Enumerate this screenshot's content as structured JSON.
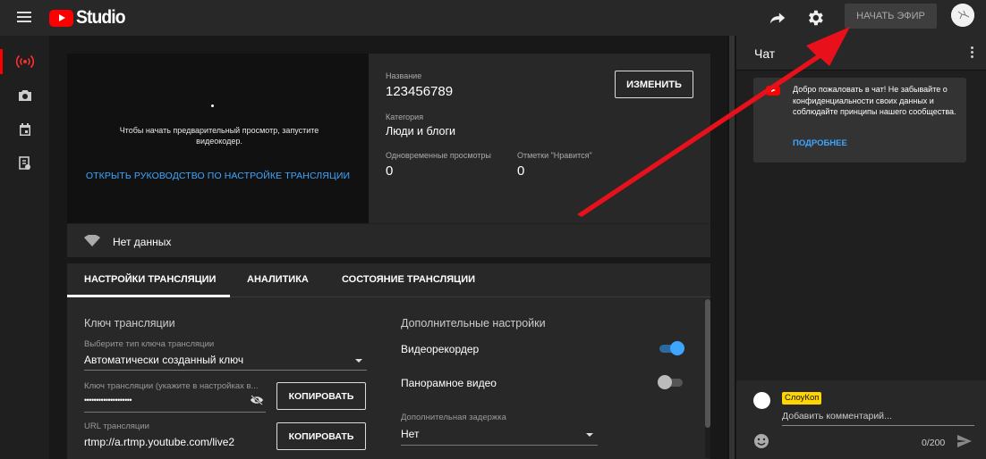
{
  "header": {
    "logo_text": "Studio",
    "go_live_label": "НАЧАТЬ ЭФИР"
  },
  "icons": {
    "menu": "menu-icon",
    "share": "share-arrow-icon",
    "settings": "gear-icon",
    "rail": [
      "live-broadcast-icon",
      "camera-icon",
      "calendar-icon",
      "upload-list-icon"
    ],
    "status": "wifi-signal-icon",
    "visibility": "eye-off-icon",
    "dropdown": "caret-down-icon",
    "emoji": "emoji-icon",
    "send": "send-icon"
  },
  "preview": {
    "message": "Чтобы начать предварительный просмотр, запустите видеокодер.",
    "guide_link": "ОТКРЫТЬ РУКОВОДСТВО ПО НАСТРОЙКЕ ТРАНСЛЯЦИИ",
    "status_text": "Нет данных"
  },
  "info": {
    "title_label": "Название",
    "title_value": "123456789",
    "category_label": "Категория",
    "category_value": "Люди и блоги",
    "concurrent_label": "Одновременные просмотры",
    "concurrent_value": "0",
    "likes_label": "Отметки \"Нравится\"",
    "likes_value": "0",
    "edit_label": "ИЗМЕНИТЬ"
  },
  "tabs": [
    {
      "label": "НАСТРОЙКИ ТРАНСЛЯЦИИ",
      "active": true
    },
    {
      "label": "АНАЛИТИКА",
      "active": false
    },
    {
      "label": "СОСТОЯНИЕ ТРАНСЛЯЦИИ",
      "active": false
    }
  ],
  "stream_key": {
    "section_title": "Ключ трансляции",
    "key_type_label": "Выберите тип ключа трансляции",
    "key_type_value": "Автоматически созданный ключ",
    "key_label": "Ключ трансляции (укажите в настройках в...",
    "key_value": "••••••••••••••••••••",
    "copy_label": "КОПИРОВАТЬ",
    "url_label": "URL трансляции",
    "url_value": "rtmp://a.rtmp.youtube.com/live2",
    "copy_url_label": "КОПИРОВАТЬ"
  },
  "advanced": {
    "section_title": "Дополнительные настройки",
    "dvr_label": "Видеорекордер",
    "dvr_on": true,
    "panorama_label": "Панорамное видео",
    "panorama_on": false,
    "latency_label": "Дополнительная задержка",
    "latency_value": "Нет"
  },
  "chat": {
    "title": "Чат",
    "welcome_text": "Добро пожаловать в чат! Не забывайте о конфиденциальности своих данных и соблюдайте принципы нашего сообщества.",
    "learn_more": "ПОДРОБНЕЕ",
    "username": "СлоуКоп",
    "input_placeholder": "Добавить комментарий...",
    "counter": "0/200"
  },
  "colors": {
    "accent_blue": "#3ea6ff",
    "brand_red": "#ff0000",
    "annotation_red": "#e8101a",
    "badge_yellow": "#ffd600"
  }
}
